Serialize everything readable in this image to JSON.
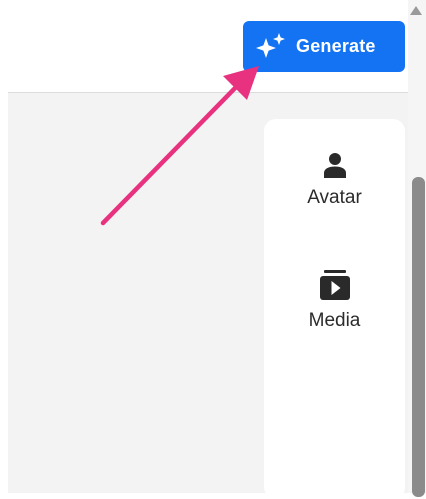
{
  "toolbar": {
    "generate_label": "Generate",
    "generate_icon": "sparkle-icon",
    "accent_color": "#1473f3"
  },
  "side_panel": {
    "items": [
      {
        "label": "Avatar",
        "icon": "avatar-icon"
      },
      {
        "label": "Media",
        "icon": "media-icon"
      }
    ]
  },
  "annotation": {
    "arrow_color": "#e8327f",
    "target": "generate-button"
  }
}
